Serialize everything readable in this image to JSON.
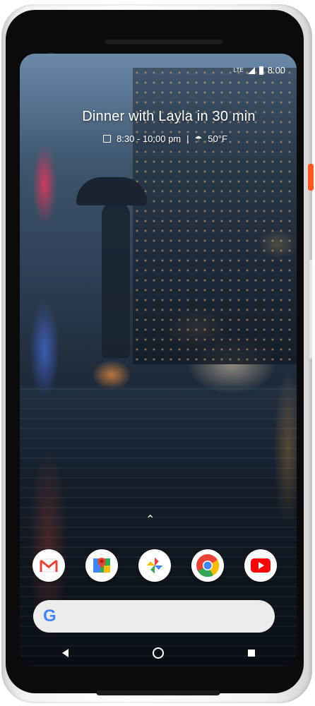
{
  "status_bar": {
    "network": "LTE",
    "time": "8:00"
  },
  "at_a_glance": {
    "event": "Dinner with Layla in 30 min",
    "time_range": "8:30 - 10:00 pm",
    "separator": "|",
    "weather": "50°F"
  },
  "dock": {
    "apps": [
      {
        "name": "Gmail",
        "icon": "gmail-icon"
      },
      {
        "name": "Maps",
        "icon": "maps-icon"
      },
      {
        "name": "Photos",
        "icon": "photos-icon"
      },
      {
        "name": "Chrome",
        "icon": "chrome-icon"
      },
      {
        "name": "YouTube",
        "icon": "youtube-icon"
      }
    ]
  },
  "search_bar": {
    "logo": "G"
  },
  "nav_bar": {
    "buttons": [
      "back",
      "home",
      "recents"
    ]
  },
  "colors": {
    "accent_power_key": "#ff5722",
    "gmail_red": "#ea4335",
    "google_blue": "#4285f4",
    "google_green": "#34a853",
    "google_yellow": "#fbbc05"
  }
}
